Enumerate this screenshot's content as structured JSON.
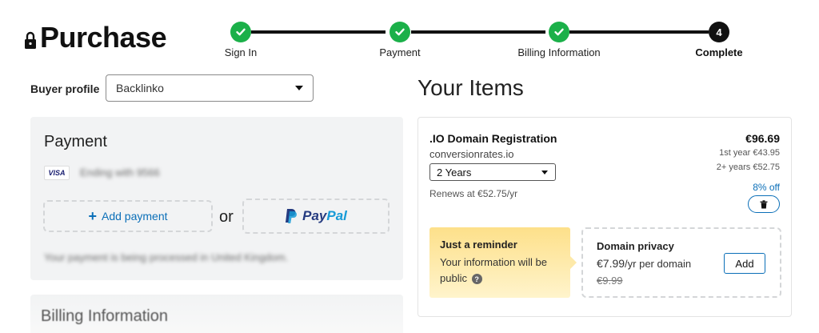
{
  "header": {
    "title": "Purchase",
    "steps": [
      {
        "label": "Sign In",
        "status": "done"
      },
      {
        "label": "Payment",
        "status": "done"
      },
      {
        "label": "Billing Information",
        "status": "done"
      },
      {
        "label": "Complete",
        "status": "current",
        "number": "4"
      }
    ]
  },
  "buyer": {
    "label": "Buyer profile",
    "selected": "Backlinko"
  },
  "payment": {
    "title": "Payment",
    "card_brand": "VISA",
    "card_text": "Ending with 9566",
    "add_label": "Add payment",
    "or_label": "or",
    "paypal_part1": "Pay",
    "paypal_part2": "Pal",
    "note": "Your payment is being processed in United Kingdom."
  },
  "billing": {
    "title": "Billing Information"
  },
  "items": {
    "title": "Your Items",
    "item": {
      "name": ".IO Domain Registration",
      "domain": "conversionrates.io",
      "term": "2 Years",
      "renews": "Renews at €52.75/yr",
      "price": "€96.69",
      "first_year": "1st year €43.95",
      "later_years": "2+ years €52.75",
      "discount": "8% off"
    },
    "reminder": {
      "title": "Just a reminder",
      "text": "Your information will be public"
    },
    "privacy": {
      "title": "Domain privacy",
      "price": "€7.99",
      "unit": "/yr per domain",
      "old_price": "€9.99",
      "add_label": "Add"
    }
  },
  "colors": {
    "success": "#1bb049",
    "link": "#0b6fb8",
    "reminder": "#fde08a"
  }
}
